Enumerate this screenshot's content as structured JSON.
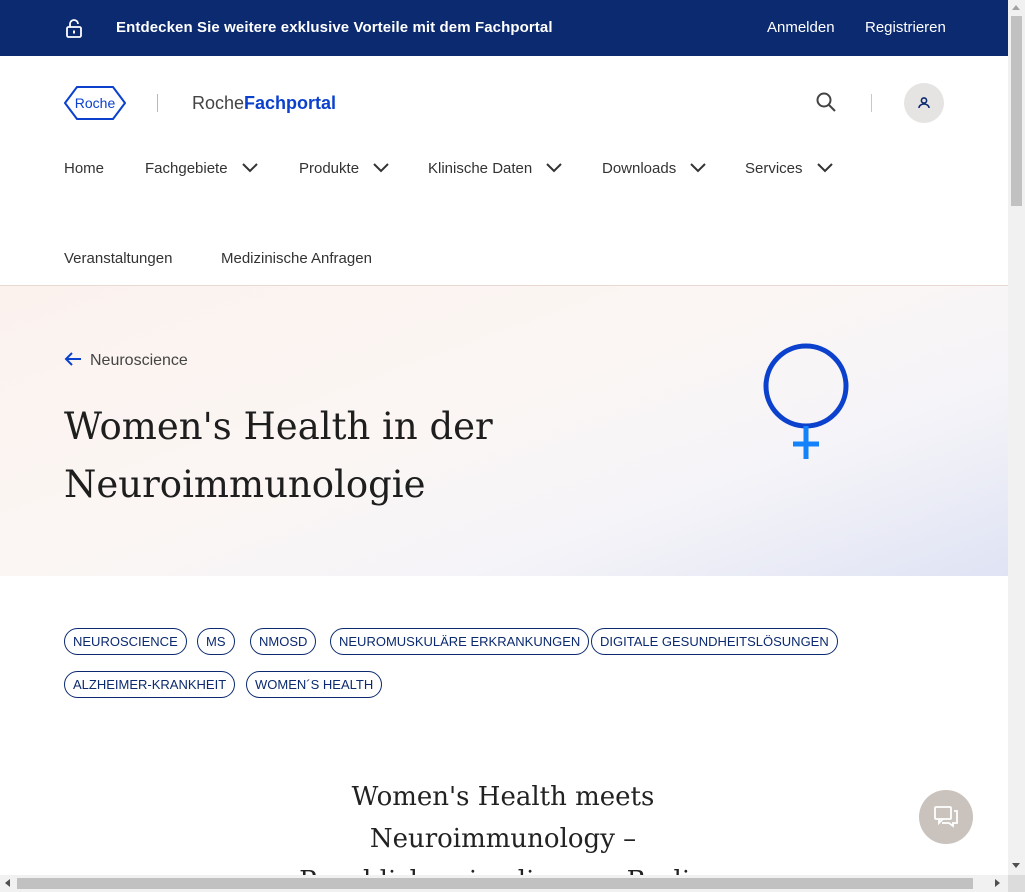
{
  "promo": {
    "message": "Entdecken Sie weitere exklusive Vorteile mit dem Fachportal",
    "login_label": "Anmelden",
    "register_label": "Registrieren",
    "icon": "unlock-icon"
  },
  "header": {
    "logo_text": "Roche",
    "brand_prefix": "Roche",
    "brand_suffix": "Fachportal",
    "search_icon": "search-icon",
    "user_icon": "user-icon"
  },
  "nav": {
    "items": [
      {
        "label": "Home",
        "has_dropdown": false
      },
      {
        "label": "Fachgebiete",
        "has_dropdown": true
      },
      {
        "label": "Produkte",
        "has_dropdown": true
      },
      {
        "label": "Klinische Daten",
        "has_dropdown": true
      },
      {
        "label": "Downloads",
        "has_dropdown": true
      },
      {
        "label": "Services",
        "has_dropdown": true
      },
      {
        "label": "Veranstaltungen",
        "has_dropdown": false
      },
      {
        "label": "Medizinische Anfragen",
        "has_dropdown": false
      }
    ]
  },
  "hero": {
    "back_label": "Neuroscience",
    "title_line1": "Women's Health in der",
    "title_line2": "Neuroimmunologie",
    "symbol_icon": "venus-symbol-icon"
  },
  "tags": [
    "NEUROSCIENCE",
    "MS",
    "NMOSD",
    "NEUROMUSKULÄRE ERKRANKUNGEN",
    "DIGITALE GESUNDHEITSLÖSUNGEN",
    "ALZHEIMER-KRANKHEIT",
    "WOMEN´S HEALTH"
  ],
  "section": {
    "title_line1": "Women's Health meets",
    "title_line2": "Neuroimmunology –",
    "title_line3": "Paneldiskussion live aus Berlin"
  },
  "chat": {
    "icon": "chat-icon"
  },
  "colors": {
    "promo_bg": "#0b2a6f",
    "brand_blue": "#0b41cd",
    "tag_border": "#0b2a6f",
    "chat_bg": "#c9c2bd"
  }
}
